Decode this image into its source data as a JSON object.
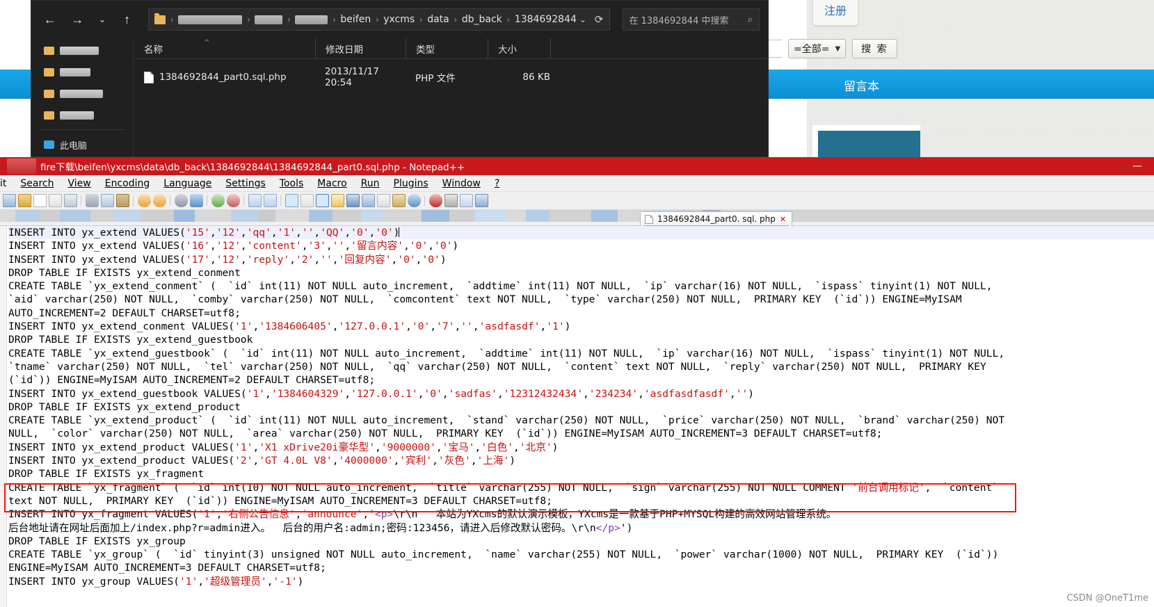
{
  "webpage": {
    "register_tab": "注册",
    "select_value": "=全部=",
    "search_button": "搜 索",
    "section_title": "留言本"
  },
  "explorer": {
    "nav": {
      "back_icon": "back-arrow-icon",
      "forward_icon": "forward-arrow-icon",
      "recent_icon": "chevron-down-icon",
      "up_icon": "up-arrow-icon",
      "refresh_icon": "refresh-icon",
      "dropdown_icon": "chevron-down-icon",
      "search_icon": "search-icon"
    },
    "breadcrumbs": [
      "beifen",
      "yxcms",
      "data",
      "db_back",
      "1384692844"
    ],
    "search_placeholder": "在 1384692844 中搜索",
    "columns": [
      "名称",
      "修改日期",
      "类型",
      "大小"
    ],
    "rows": [
      {
        "name": "1384692844_part0.sql.php",
        "modified": "2013/11/17 20:54",
        "type": "PHP 文件",
        "size": "86 KB"
      }
    ],
    "sidebar_text_item": "此电脑"
  },
  "notepad": {
    "title": "fire下载\\beifen\\yxcms\\data\\db_back\\1384692844\\1384692844_part0.sql.php - Notepad++",
    "minimize_label": "—",
    "menu": [
      "it",
      "Search",
      "View",
      "Encoding",
      "Language",
      "Settings",
      "Tools",
      "Macro",
      "Run",
      "Plugins",
      "Window",
      "?"
    ],
    "tab_label": "1384692844_part0. sql. php",
    "tab_close": "✕",
    "lines": [
      "INSERT INTO yx_extend VALUES('15','12','qq','1','','QQ','0','0')",
      "INSERT INTO yx_extend VALUES('16','12','content','3','','留言内容','0','0')",
      "INSERT INTO yx_extend VALUES('17','12','reply','2','','回复内容','0','0')",
      "DROP TABLE IF EXISTS yx_extend_conment",
      "CREATE TABLE `yx_extend_conment` (  `id` int(11) NOT NULL auto_increment,  `addtime` int(11) NOT NULL,  `ip` varchar(16) NOT NULL,  `ispass` tinyint(1) NOT NULL,",
      "`aid` varchar(250) NOT NULL,  `comby` varchar(250) NOT NULL,  `comcontent` text NOT NULL,  `type` varchar(250) NOT NULL,  PRIMARY KEY  (`id`)) ENGINE=MyISAM",
      "AUTO_INCREMENT=2 DEFAULT CHARSET=utf8;",
      "INSERT INTO yx_extend_conment VALUES('1','1384606405','127.0.0.1','0','7','','asdfasdf','1')",
      "DROP TABLE IF EXISTS yx_extend_guestbook",
      "CREATE TABLE `yx_extend_guestbook` (  `id` int(11) NOT NULL auto_increment,  `addtime` int(11) NOT NULL,  `ip` varchar(16) NOT NULL,  `ispass` tinyint(1) NOT NULL,",
      "`tname` varchar(250) NOT NULL,  `tel` varchar(250) NOT NULL,  `qq` varchar(250) NOT NULL,  `content` text NOT NULL,  `reply` varchar(250) NOT NULL,  PRIMARY KEY",
      "(`id`)) ENGINE=MyISAM AUTO_INCREMENT=2 DEFAULT CHARSET=utf8;",
      "INSERT INTO yx_extend_guestbook VALUES('1','1384604329','127.0.0.1','0','sadfas','12312432434','234234','asdfasdfasdf','')",
      "DROP TABLE IF EXISTS yx_extend_product",
      "CREATE TABLE `yx_extend_product` (  `id` int(11) NOT NULL auto_increment,  `stand` varchar(250) NOT NULL,  `price` varchar(250) NOT NULL,  `brand` varchar(250) NOT",
      "NULL,  `color` varchar(250) NOT NULL,  `area` varchar(250) NOT NULL,  PRIMARY KEY  (`id`)) ENGINE=MyISAM AUTO_INCREMENT=3 DEFAULT CHARSET=utf8;",
      "INSERT INTO yx_extend_product VALUES('1','X1 xDrive20i豪华型','9000000','宝马','白色','北京')",
      "INSERT INTO yx_extend_product VALUES('2','GT 4.0L V8','4000000','宾利','灰色','上海')",
      "DROP TABLE IF EXISTS yx_fragment",
      "CREATE TABLE `yx_fragment` (  `id` int(10) NOT NULL auto_increment,  `title` varchar(255) NOT NULL,  `sign` varchar(255) NOT NULL COMMENT '前台调用标记',  `content`",
      "text NOT NULL,  PRIMARY KEY  (`id`)) ENGINE=MyISAM AUTO_INCREMENT=3 DEFAULT CHARSET=utf8;",
      "INSERT INTO yx_fragment VALUES('1','右侧公告信息','announce','<p>\\r\\n   本站为YXcms的默认演示模板，YXcms是一款基于PHP+MYSQL构建的高效网站管理系统。",
      "后台地址请在网址后面加上/index.php?r=admin进入。  后台的用户名:admin;密码:123456，请进入后修改默认密码。\\r\\n</p>')",
      "DROP TABLE IF EXISTS yx_group",
      "CREATE TABLE `yx_group` (  `id` tinyint(3) unsigned NOT NULL auto_increment,  `name` varchar(255) NOT NULL,  `power` varchar(1000) NOT NULL,  PRIMARY KEY  (`id`))",
      "ENGINE=MyISAM AUTO_INCREMENT=3 DEFAULT CHARSET=utf8;",
      "INSERT INTO yx_group VALUES('1','超级管理员','-1')"
    ]
  },
  "watermark": "CSDN @OneT1me",
  "colors": {
    "npp_title_bg": "#c8191d",
    "highlight_border": "#fa1408",
    "accent_blue": "#19a8e8",
    "tab_underline": "#e8a33d",
    "string_red": "#c81010",
    "tag_purple": "#7a3ea8"
  }
}
